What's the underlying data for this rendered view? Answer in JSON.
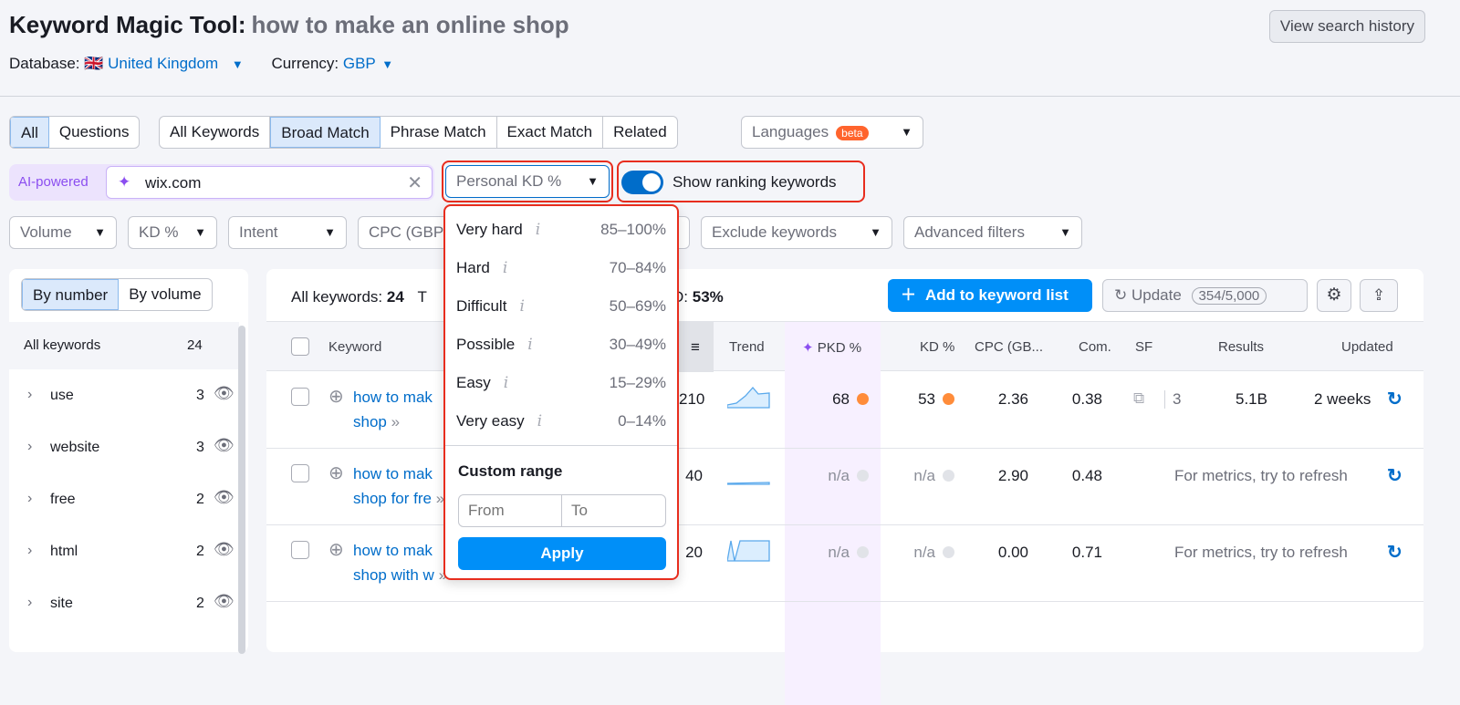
{
  "header": {
    "title": "Keyword Magic Tool:",
    "query": "how to make an online shop",
    "database_label": "Database:",
    "database_value": "United Kingdom",
    "flag": "🇬🇧",
    "currency_label": "Currency:",
    "currency_value": "GBP",
    "history_button": "View search history"
  },
  "tabs": {
    "scope": [
      "All",
      "Questions"
    ],
    "match": [
      "All Keywords",
      "Broad Match",
      "Phrase Match",
      "Exact Match",
      "Related"
    ],
    "languages": "Languages",
    "beta": "beta"
  },
  "ai": {
    "label": "AI-powered",
    "domain": "wix.com",
    "pkd_dropdown": "Personal KD %",
    "toggle_label": "Show ranking keywords",
    "toggle_on": true
  },
  "filters": [
    "Volume",
    "KD %",
    "Intent",
    "CPC (GBP)",
    "Exclude keywords",
    "Advanced filters"
  ],
  "pkd_menu": {
    "items": [
      {
        "label": "Very hard",
        "range": "85–100%"
      },
      {
        "label": "Hard",
        "range": "70–84%"
      },
      {
        "label": "Difficult",
        "range": "50–69%"
      },
      {
        "label": "Possible",
        "range": "30–49%"
      },
      {
        "label": "Easy",
        "range": "15–29%"
      },
      {
        "label": "Very easy",
        "range": "0–14%"
      }
    ],
    "custom_title": "Custom range",
    "from_placeholder": "From",
    "to_placeholder": "To",
    "apply": "Apply"
  },
  "sidebar": {
    "toggle": [
      "By number",
      "By volume"
    ],
    "all_label": "All keywords",
    "all_count": "24",
    "groups": [
      {
        "label": "use",
        "count": "3"
      },
      {
        "label": "website",
        "count": "3"
      },
      {
        "label": "free",
        "count": "2"
      },
      {
        "label": "html",
        "count": "2"
      },
      {
        "label": "site",
        "count": "2"
      }
    ]
  },
  "summary": {
    "all_label": "All keywords:",
    "all_value": "24",
    "t": "T",
    "kd_suffix": "D:",
    "kd_value": "53%",
    "add_button": "Add to keyword list",
    "update_button": "Update",
    "update_count": "354/5,000"
  },
  "table": {
    "columns": [
      "Keyword",
      "Trend",
      "PKD %",
      "KD %",
      "CPC (GB...",
      "Com.",
      "SF",
      "Results",
      "Updated"
    ],
    "rows": [
      {
        "kw1": "how to mak",
        "kw2": "shop",
        "vol": "210",
        "pkd": "68",
        "pkd_color": "#ff8c3a",
        "kd": "53",
        "kd_color": "#ff8c3a",
        "cpc": "2.36",
        "com": "0.38",
        "sf": "3",
        "results": "5.1B",
        "updated": "2 weeks"
      },
      {
        "kw1": "how to mak",
        "kw2": "shop for fre",
        "vol": "40",
        "pkd": "n/a",
        "pkd_color": "#e1e3e8",
        "kd": "n/a",
        "kd_color": "#e1e3e8",
        "cpc": "2.90",
        "com": "0.48",
        "note": "For metrics, try to refresh"
      },
      {
        "kw1": "how to mak",
        "kw2": "shop with w",
        "vol": "20",
        "pkd": "n/a",
        "pkd_color": "#e1e3e8",
        "kd": "n/a",
        "kd_color": "#e1e3e8",
        "cpc": "0.00",
        "com": "0.71",
        "note": "For metrics, try to refresh"
      }
    ]
  }
}
